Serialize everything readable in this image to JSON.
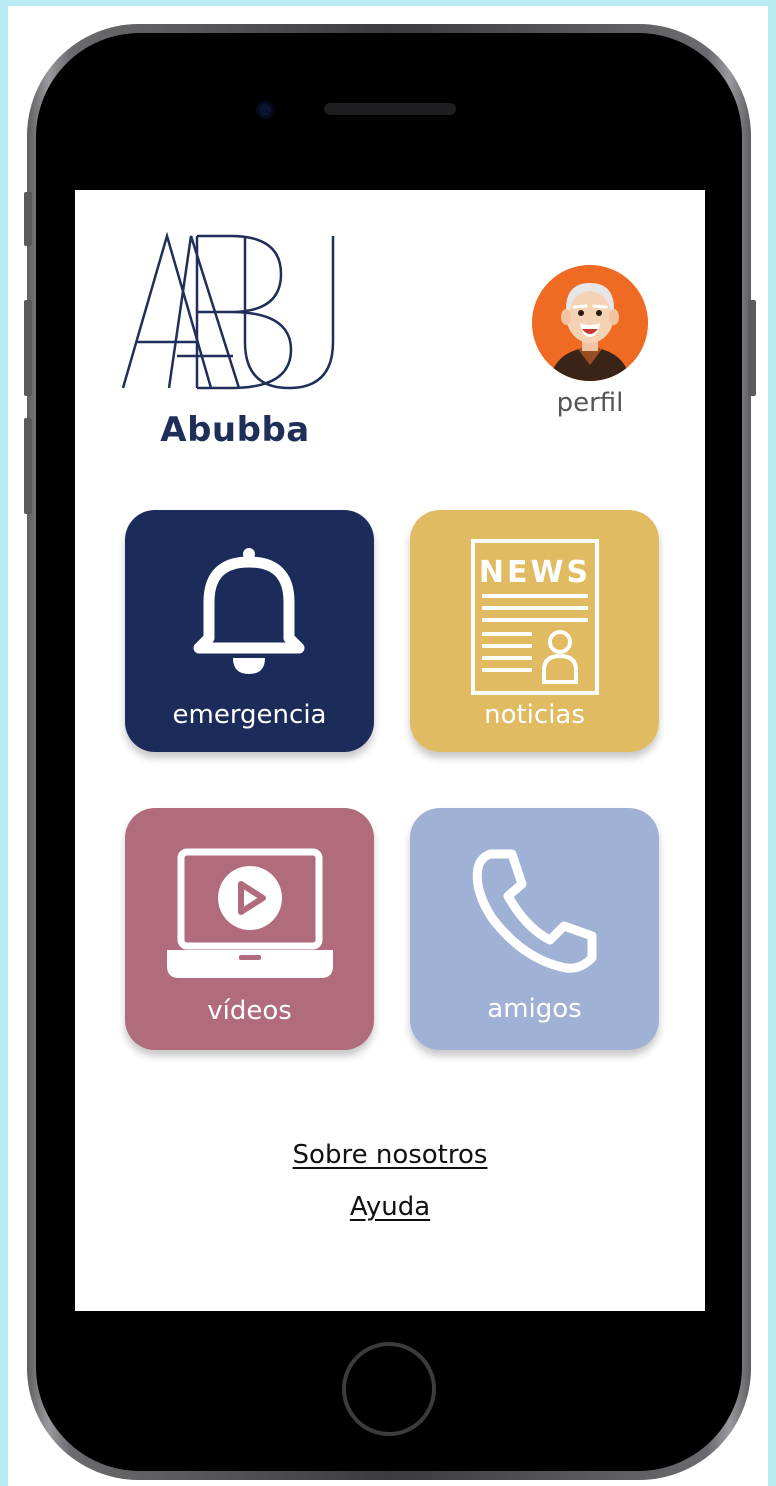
{
  "app": {
    "name": "Abubba",
    "logo_mark": "ABU"
  },
  "profile": {
    "label": "perfil",
    "avatar_icon": "elderly-man-avatar"
  },
  "tiles": [
    {
      "label": "emergencia",
      "icon": "bell-icon",
      "color": "#1b2b5a"
    },
    {
      "label": "noticias",
      "icon": "newspaper-icon",
      "icon_text": "NEWS",
      "color": "#e0bb62"
    },
    {
      "label": "vídeos",
      "icon": "laptop-play-icon",
      "color": "#b06b7d"
    },
    {
      "label": "amigos",
      "icon": "phone-icon",
      "color": "#a0b1d6"
    }
  ],
  "links": {
    "about": "Sobre nosotros",
    "help": "Ayuda"
  },
  "colors": {
    "background": "#b8ecf2",
    "brand": "#1f2f5a",
    "avatar_bg": "#ef6a22"
  }
}
